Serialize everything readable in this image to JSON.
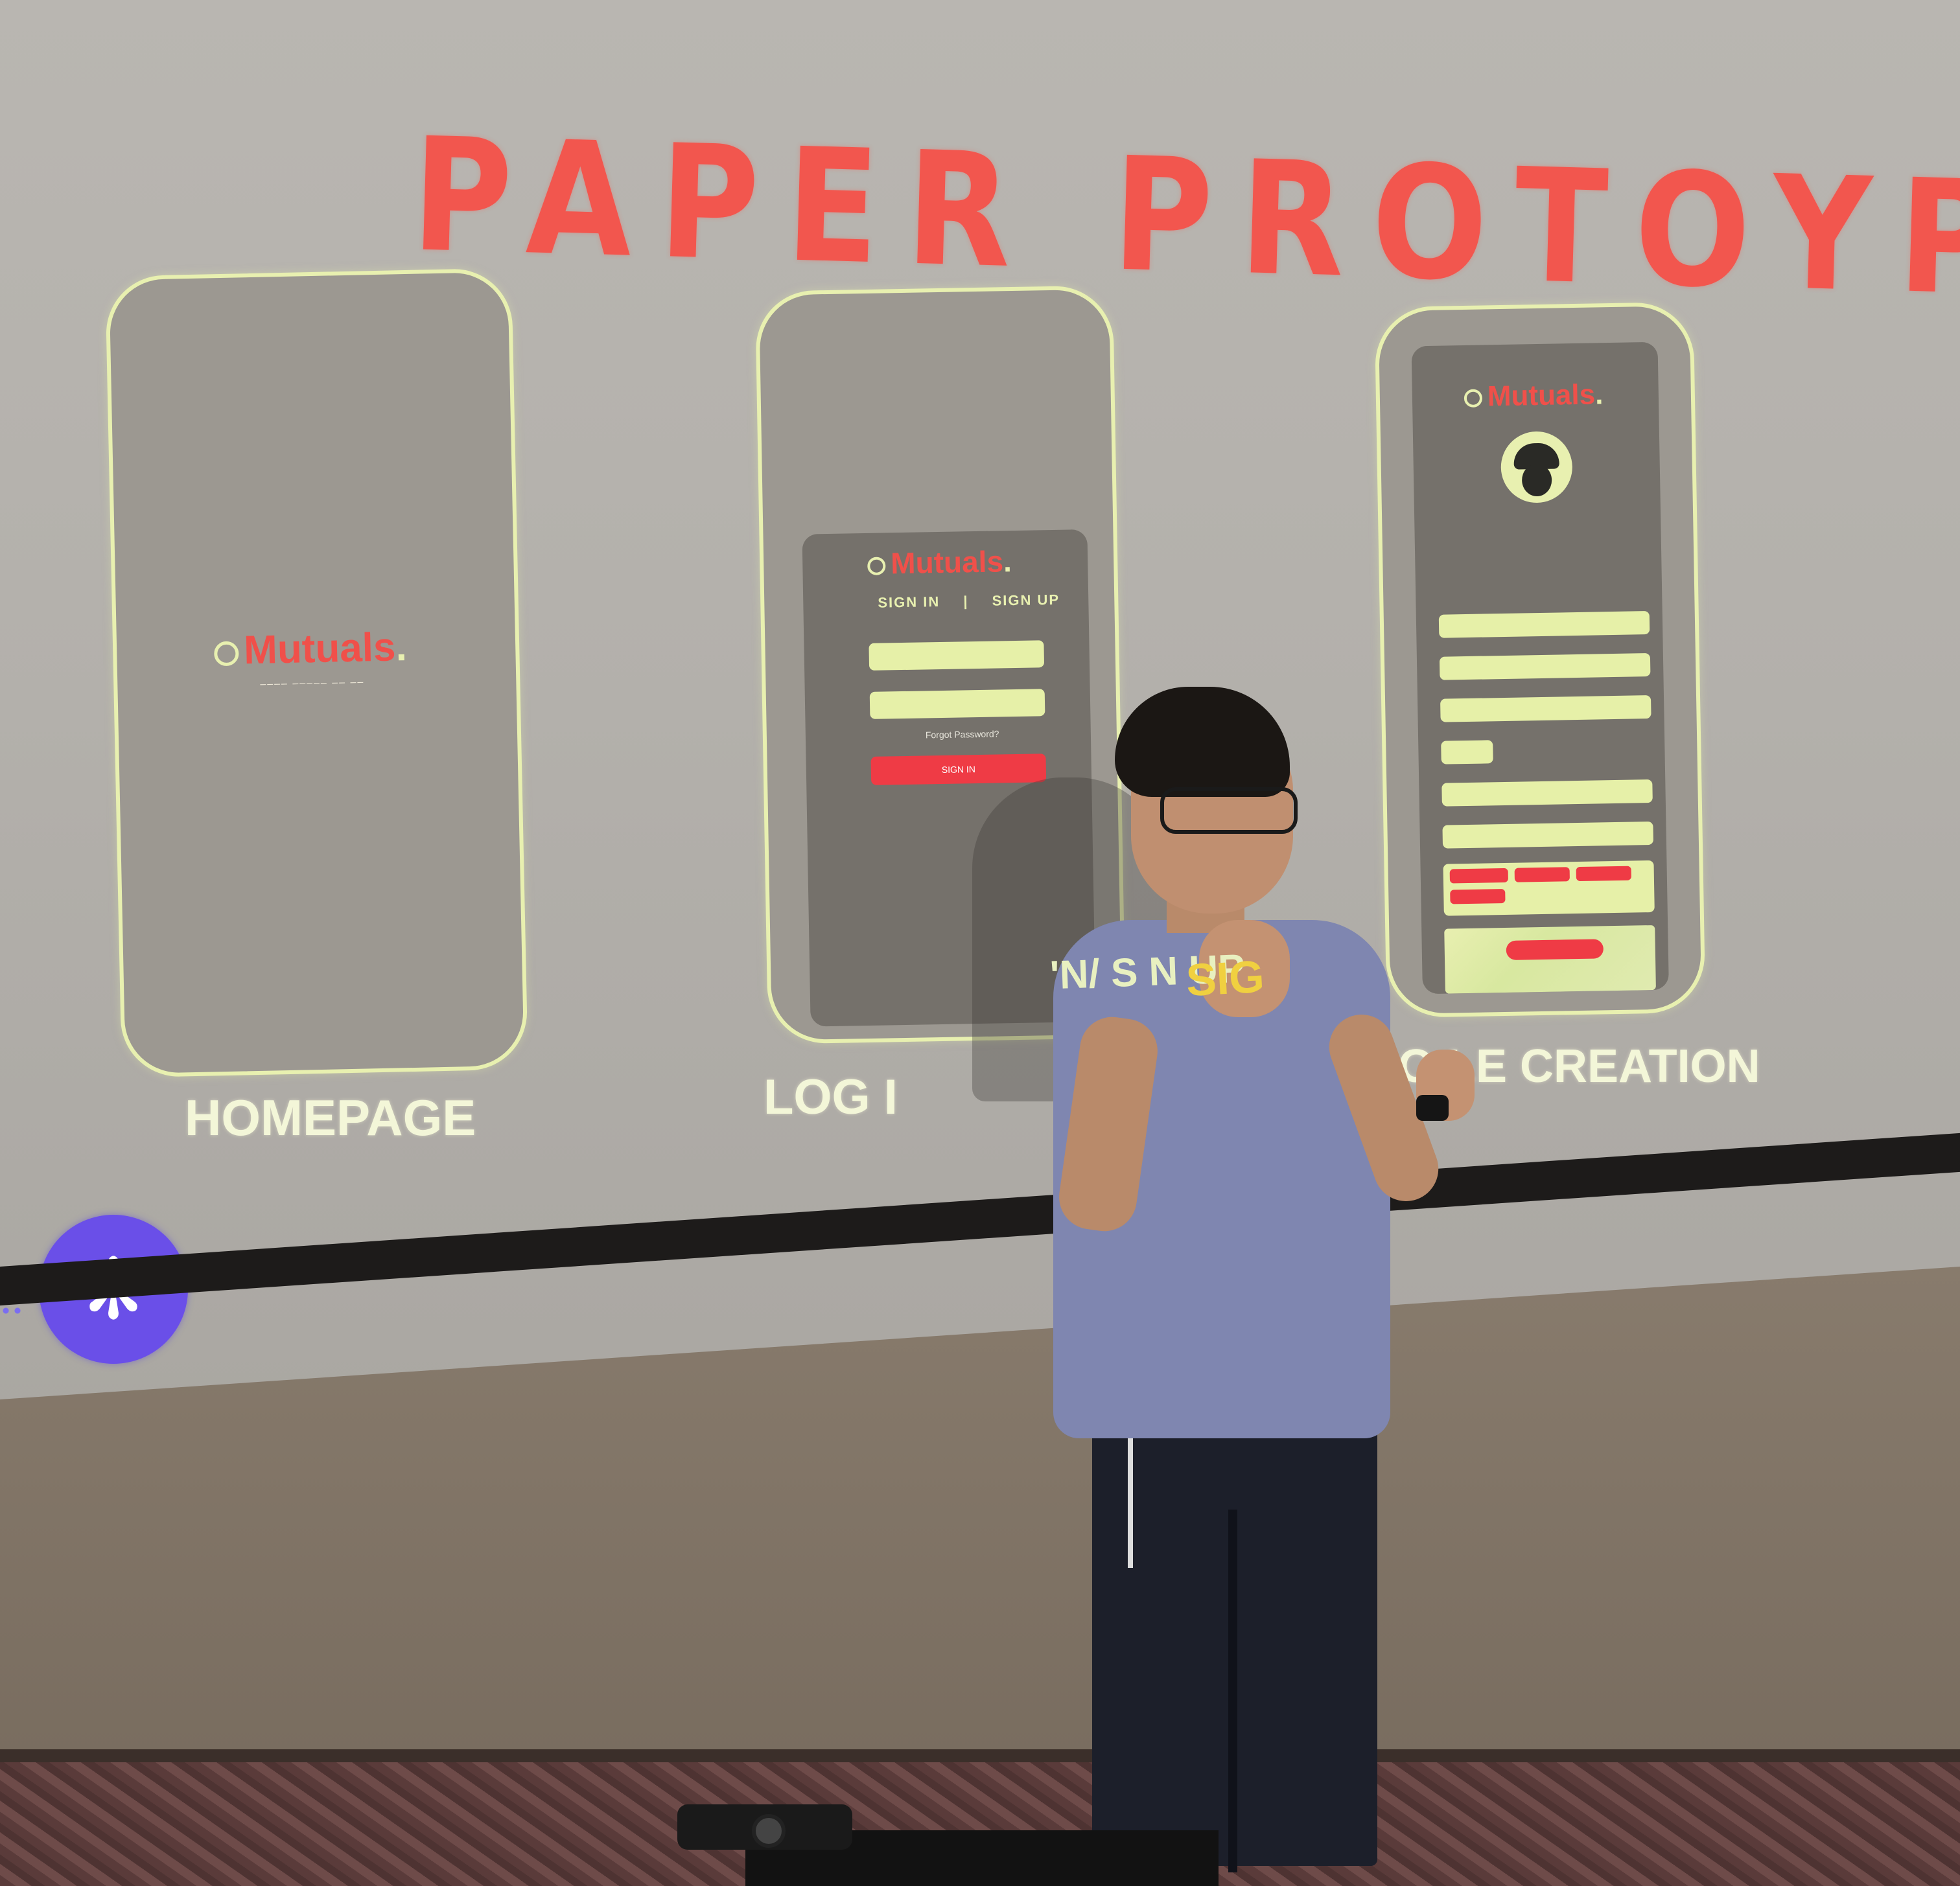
{
  "slide": {
    "title": "PAPER PROTOYPE",
    "phones": [
      {
        "caption": "HOMEPAGE",
        "brand": "Mutuals",
        "brand_suffix": ".",
        "tagline": "–––– ––––– –– ––"
      },
      {
        "caption": "LOG I",
        "brand": "Mutuals",
        "brand_suffix": ".",
        "tab_sign_in": "SIGN IN",
        "tab_separator": "|",
        "tab_sign_up": "SIGN UP",
        "forgot_text": "Forgot Password?",
        "button_label": "SIGN IN"
      },
      {
        "caption": "RO LE CREATION",
        "brand": "Mutuals",
        "brand_suffix": "."
      }
    ],
    "projected_on_shirt": "'N/ S  N UP",
    "projected_sig": "SIG"
  },
  "colors": {
    "title_red": "#f2564e",
    "phone_outline": "#e8f0b0",
    "accent_button": "#6a4fe8"
  },
  "icons": {
    "gear_button": "gear-icon"
  }
}
